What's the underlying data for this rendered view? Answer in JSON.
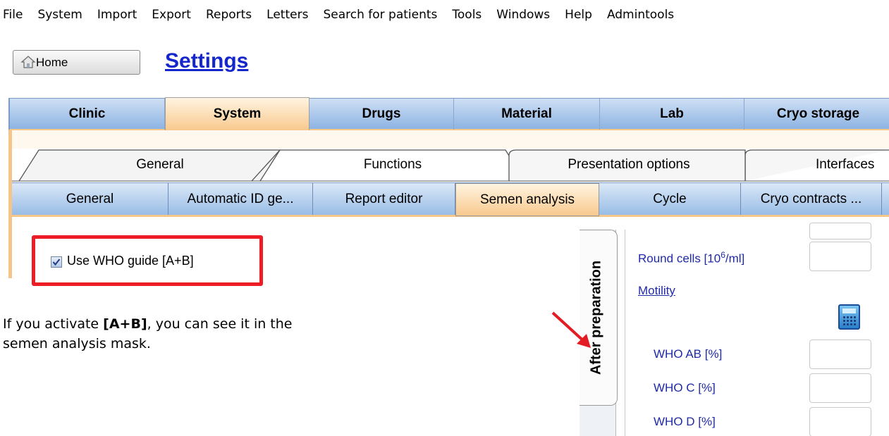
{
  "menu": [
    "File",
    "System",
    "Import",
    "Export",
    "Reports",
    "Letters",
    "Search for patients",
    "Tools",
    "Windows",
    "Help",
    "Admintools"
  ],
  "home_button": "Home",
  "page_title": "Settings",
  "main_tabs": [
    "Clinic",
    "System",
    "Drugs",
    "Material",
    "Lab",
    "Cryo storage"
  ],
  "main_tab_active": "System",
  "sub_tabs": [
    "General",
    "Functions",
    "Presentation options",
    "Interfaces"
  ],
  "third_tabs": [
    "General",
    "Automatic ID ge...",
    "Report editor",
    "Semen analysis",
    "Cycle",
    "Cryo contracts ..."
  ],
  "third_tab_active": "Semen analysis",
  "checkbox": {
    "label": "Use WHO guide [A+B]",
    "checked": true
  },
  "explanation": {
    "prefix": "If you activate ",
    "bold": "[A+B]",
    "suffix": ", you can see it in the semen analysis mask."
  },
  "side_tab": "After preparation",
  "mask": {
    "round_cells_label": "Round cells [10",
    "round_cells_exp": "6",
    "round_cells_unit": "/ml]",
    "motility_link": "Motility",
    "who_ab": "WHO AB [%]",
    "who_c": "WHO C [%]",
    "who_d": "WHO D [%]"
  },
  "colors": {
    "highlight_box": "#ee1c24",
    "title": "#1426cc",
    "tab_active": "#f8c98e",
    "tab_bar": "#8db3e2"
  }
}
